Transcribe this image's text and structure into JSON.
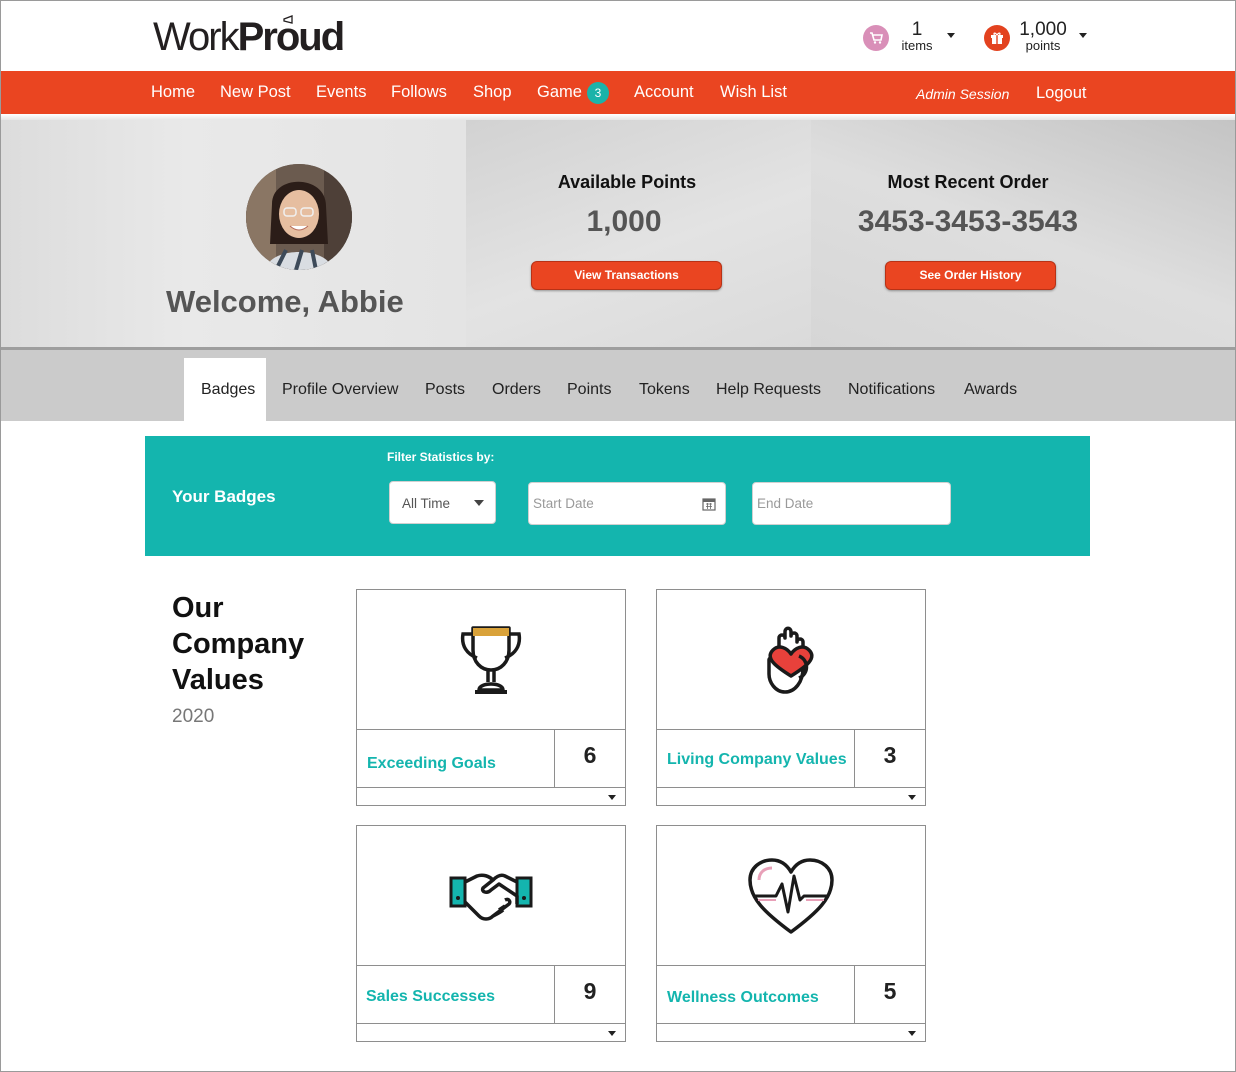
{
  "brand": {
    "logo_work": "Work",
    "logo_proud": "Proud"
  },
  "header": {
    "cart_count": "1",
    "cart_label": "items",
    "points_count": "1,000",
    "points_label": "points"
  },
  "nav": {
    "items": [
      "Home",
      "New Post",
      "Events",
      "Follows",
      "Shop",
      "Game",
      "Account",
      "Wish List"
    ],
    "game_badge": "3",
    "admin_session": "Admin Session",
    "logout": "Logout"
  },
  "hero": {
    "welcome": "Welcome, Abbie",
    "points_title": "Available Points",
    "points_value": "1,000",
    "points_button": "View Transactions",
    "order_title": "Most Recent Order",
    "order_value": "3453-3453-3543",
    "order_button": "See Order History"
  },
  "tabs": [
    "Badges",
    "Profile Overview",
    "Posts",
    "Orders",
    "Points",
    "Tokens",
    "Help Requests",
    "Notifications",
    "Awards"
  ],
  "filter": {
    "title": "Your Badges",
    "label": "Filter Statistics by:",
    "range_value": "All Time",
    "start_placeholder": "Start Date",
    "end_placeholder": "End Date"
  },
  "values": {
    "title_line1": "Our",
    "title_line2": "Company",
    "title_line3": "Values",
    "year": "2020",
    "badges": [
      {
        "name": "Exceeding Goals",
        "count": "6",
        "icon": "trophy-icon"
      },
      {
        "name": "Living Company Values",
        "count": "3",
        "icon": "hand-heart-icon"
      },
      {
        "name": "Sales Successes",
        "count": "9",
        "icon": "handshake-icon"
      },
      {
        "name": "Wellness Outcomes",
        "count": "5",
        "icon": "heartbeat-icon"
      }
    ]
  },
  "colors": {
    "brand_orange": "#ea4521",
    "teal": "#14b5ae",
    "cart_pink": "#d98fb8"
  }
}
